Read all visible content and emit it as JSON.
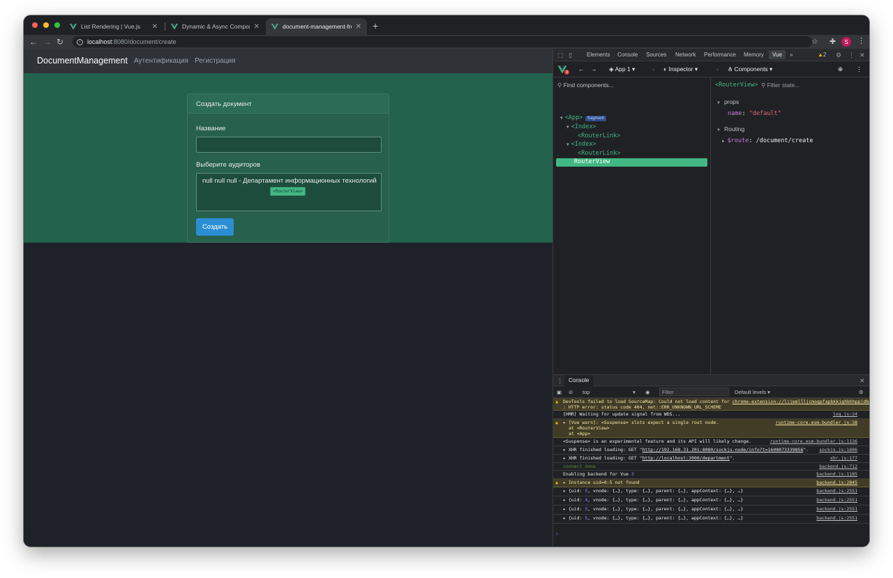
{
  "browser": {
    "tabs": [
      {
        "title": "List Rendering | Vue.js",
        "active": false
      },
      {
        "title": "Dynamic & Async Components",
        "active": false
      },
      {
        "title": "document-management-frontend",
        "active": true
      }
    ],
    "new_tab": "+",
    "url_host": "localhost",
    "url_path": ":8080/document/create",
    "profile_initial": "S"
  },
  "app": {
    "brand": "DocumentManagement",
    "nav_links": [
      "Аутентификация",
      "Регистрация"
    ],
    "card_title": "Создать документ",
    "name_label": "Название",
    "name_value": "",
    "auditors_label": "Выберите аудиторов",
    "auditors_option": "null null null - Департамент информационных технологий",
    "submit_label": "Создать",
    "routerview_badge": "<RouterView>"
  },
  "devtools": {
    "tabs": [
      "Elements",
      "Console",
      "Sources",
      "Network",
      "Performance",
      "Memory",
      "Vue"
    ],
    "active_tab": "Vue",
    "more": "»",
    "warning_count": "2",
    "vue_badge": "3",
    "app_selector": "App 1",
    "inspector_label": "Inspector",
    "components_label": "Components",
    "find_placeholder": "Find components...",
    "tree": [
      {
        "label": "<App>",
        "badge": "fragment",
        "arrow": "▼"
      },
      {
        "label": "<Index>",
        "arrow": "▼"
      },
      {
        "label": "<RouterLink>",
        "arrow": ""
      },
      {
        "label": "<Index>",
        "arrow": "▼"
      },
      {
        "label": "<RouterLink>",
        "arrow": ""
      }
    ],
    "selected_node": "RouterView",
    "inspector_title": "<RouterView>",
    "filter_state_placeholder": "Filter state...",
    "props_section": "props",
    "prop_key": "name",
    "prop_value": "\"default\"",
    "routing_section": "Routing",
    "route_key": "$route",
    "route_value": "/document/create"
  },
  "console": {
    "tab": "Console",
    "context": "top",
    "filter_placeholder": "Filter",
    "levels": "Default levels",
    "messages": [
      {
        "type": "warn",
        "text": "DevTools failed to load SourceMap: Could not load content for ",
        "link": "chrome-extension://ljjemllljcmogpfapbkkighbhhppjdbg/build/shared-data.js.map",
        "text2": ": HTTP error: status code 404, net::ERR_UNKNOWN_URL_SCHEME",
        "src": ""
      },
      {
        "type": "log",
        "text": "[HMR] Waiting for update signal from WDS...",
        "src": "log.js:24"
      },
      {
        "type": "warn",
        "text": "▸ [Vue warn]: <Suspense> slots expect a single root node.",
        "line2": "at <RouterView>",
        "line3": "at <App>",
        "src": "runtime-core.esm-bundler.js:38"
      },
      {
        "type": "log",
        "text": "<Suspense> is an experimental feature and its API will likely change.",
        "src": "runtime-core.esm-bundler.js:1136"
      },
      {
        "type": "log",
        "text": "▸ XHR finished loading: GET \"",
        "link": "http://192.168.31.201:8080/sockjs-node/info?t=1608073339856",
        "text2": "\".",
        "src": "sockjs.js:1606"
      },
      {
        "type": "log",
        "text": "▸ XHR finished loading: GET \"",
        "link": "http://localhost:3000/department",
        "text2": "\".",
        "src": "xhr.js:177"
      },
      {
        "type": "log",
        "muted": "connect done",
        "src": "backend.js:712"
      },
      {
        "type": "log",
        "text": "Enabling backend for Vue ",
        "num": "3",
        "src": "backend.js:1185"
      },
      {
        "type": "warn",
        "text": "▸ Instance uid=0:5 not found",
        "src": "backend.js:2845"
      },
      {
        "type": "log",
        "text": "▸ {uid: ",
        "num": "5",
        "text2": ", vnode: {…}, type: {…}, parent: {…}, appContext: {…}, …}",
        "src": "backend.js:2551"
      },
      {
        "type": "log",
        "text": "▸ {uid: ",
        "num": "4",
        "text2": ", vnode: {…}, type: {…}, parent: {…}, appContext: {…}, …}",
        "src": "backend.js:2551"
      },
      {
        "type": "log",
        "text": "▸ {uid: ",
        "num": "5",
        "text2": ", vnode: {…}, type: {…}, parent: {…}, appContext: {…}, …}",
        "src": "backend.js:2551"
      },
      {
        "type": "log",
        "text": "▸ {uid: ",
        "num": "5",
        "text2": ", vnode: {…}, type: {…}, parent: {…}, appContext: {…}, …}",
        "src": "backend.js:2551"
      }
    ],
    "prompt": "›"
  },
  "colors": {
    "vue_green": "#41b883",
    "page_band": "#23634e",
    "button_blue": "#2b8ed3",
    "warn_bg": "#413c26"
  }
}
